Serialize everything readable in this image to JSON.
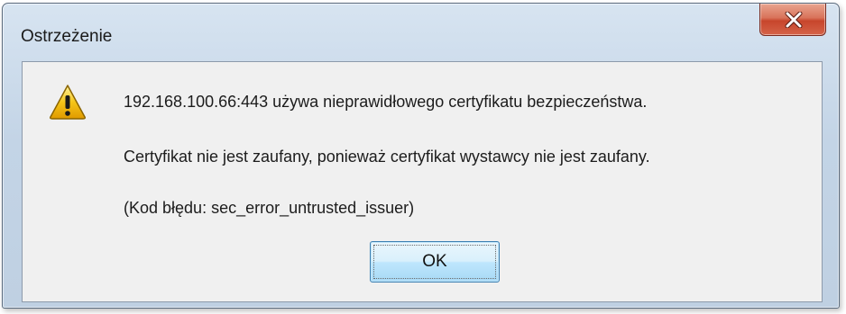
{
  "dialog": {
    "title": "Ostrzeżenie",
    "close_icon": "close-x-icon",
    "icon": "warning-triangle-icon",
    "message_line1": "192.168.100.66:443 używa nieprawidłowego certyfikatu bezpieczeństwa.",
    "message_line2": "Certyfikat nie jest zaufany, ponieważ certyfikat wystawcy nie jest zaufany.",
    "message_line3": "(Kod błędu: sec_error_untrusted_issuer)",
    "ok_label": "OK"
  },
  "colors": {
    "close_button": "#c7452c",
    "ok_button_border": "#3c7fb1",
    "warning_yellow": "#f5c518",
    "frame": "#c3d4e6"
  }
}
